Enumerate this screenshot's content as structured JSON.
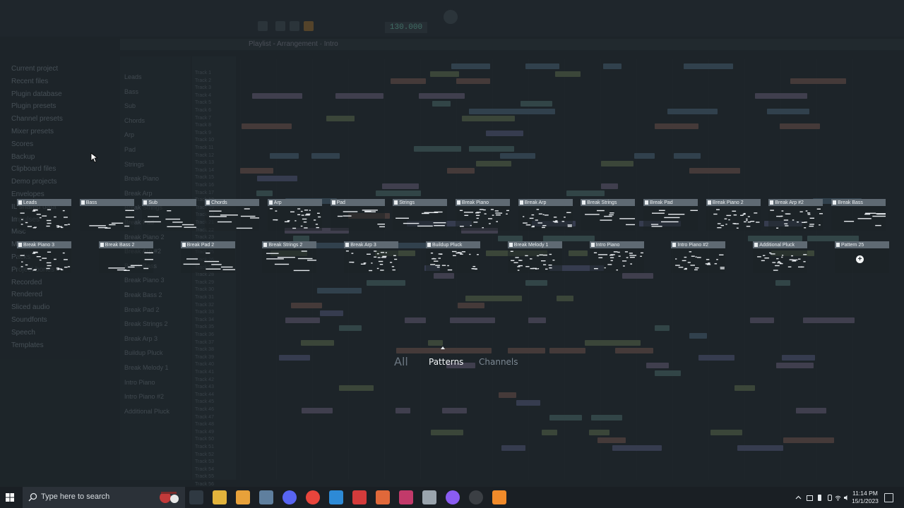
{
  "overlay": {
    "tabs": [
      {
        "label": "All",
        "active": false
      },
      {
        "label": "Patterns",
        "active": true
      },
      {
        "label": "Channels",
        "active": false
      }
    ],
    "patterns_row1": [
      "Leads",
      "Bass",
      "Sub",
      "Chords",
      "Arp",
      "Pad",
      "Strings",
      "Break Piano",
      "Break Arp",
      "Break Strings",
      "Break Pad",
      "Break Piano 2",
      "Break Arp #2",
      "Break Bass"
    ],
    "patterns_row2": [
      "Break Piano 3",
      "Break Bass 2",
      "Break Pad 2",
      "Break Strings 2",
      "Break Arp 3",
      "Buildup Pluck",
      "Break Melody 1",
      "Intro Piano",
      "Intro Piano #2",
      "Additional Pluck",
      "Pattern 25"
    ],
    "add_label": "+"
  },
  "background": {
    "tempo": "130.000",
    "playlist_title": "Playlist - Arrangement · Intro",
    "browser_items": [
      "Current project",
      "Recent files",
      "Plugin database",
      "Plugin presets",
      "Channel presets",
      "Mixer presets",
      "Scores",
      "Backup",
      "Clipboard files",
      "Demo projects",
      "Envelopes",
      "IL shared data",
      "Impulses",
      "Misc",
      "My projects",
      "Packs",
      "Project bones",
      "Recorded",
      "Rendered",
      "Sliced audio",
      "Soundfonts",
      "Speech",
      "Templates"
    ],
    "playlist_patterns": [
      "Leads",
      "Bass",
      "Sub",
      "Chords",
      "Arp",
      "Pad",
      "Strings",
      "Break Piano",
      "Break Arp",
      "Break Strings",
      "Break Pad",
      "Break Piano 2",
      "Break Arp #2",
      "Break Bass",
      "Break Piano 3",
      "Break Bass 2",
      "Break Pad 2",
      "Break Strings 2",
      "Break Arp 3",
      "Buildup Pluck",
      "Break Melody 1",
      "Intro Piano",
      "Intro Piano #2",
      "Additional Pluck"
    ]
  },
  "taskbar": {
    "search_placeholder": "Type here to search",
    "time": "11:14 PM",
    "date": "15/1/2023",
    "apps": [
      "task-view",
      "file-explorer",
      "media-player",
      "photos",
      "discord",
      "chrome",
      "vscode",
      "devtools",
      "calendar-app",
      "game-app",
      "tablet-app",
      "messenger",
      "obs",
      "fl-studio"
    ]
  }
}
